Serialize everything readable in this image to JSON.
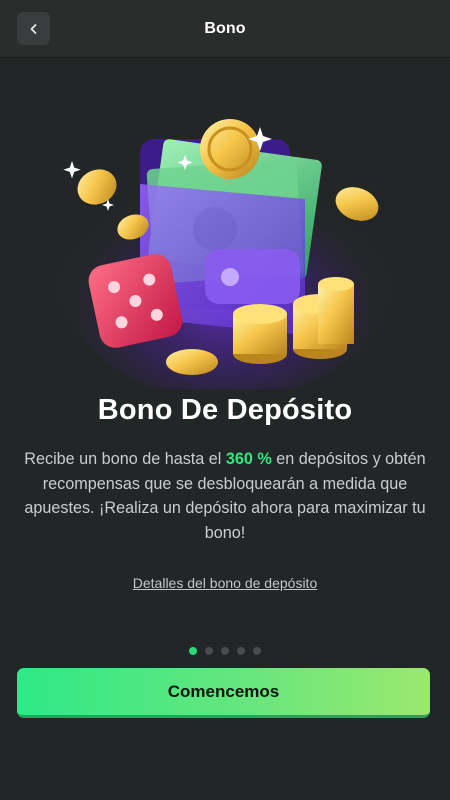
{
  "header": {
    "title": "Bono",
    "back_icon": "chevron-left-icon"
  },
  "hero": {
    "image": "wallet-coins-dice-illustration"
  },
  "main": {
    "title": "Bono De Depósito",
    "desc_before": "Recibe un bono de hasta el ",
    "desc_highlight": "360 %",
    "desc_after": " en depósitos y obtén recompensas que se desbloquearán a medida que apuestes. ¡Realiza un depósito ahora para maximizar tu bono!",
    "details_link": "Detalles del bono de depósito"
  },
  "carousel": {
    "total": 5,
    "active_index": 0
  },
  "cta": {
    "label": "Comencemos"
  },
  "colors": {
    "background": "#232626",
    "header": "#2b2d2d",
    "accent": "#33e67f",
    "cta_start": "#2ee987",
    "cta_end": "#9be86e"
  }
}
